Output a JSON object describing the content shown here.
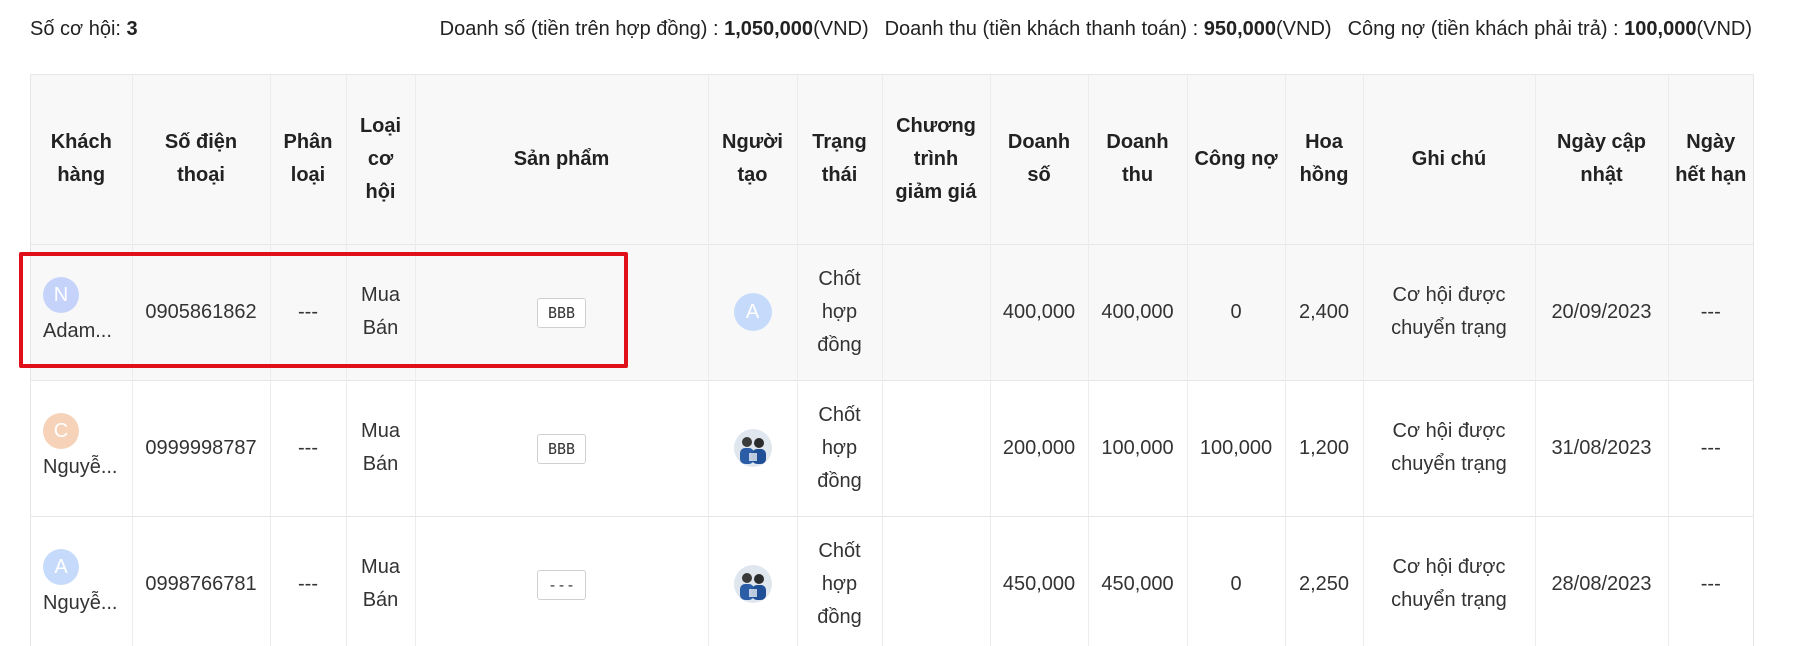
{
  "summary": {
    "count_label": "Số cơ hội: ",
    "count_value": "3",
    "sales_label": "Doanh số (tiền trên hợp đồng) : ",
    "sales_value": "1,050,000",
    "revenue_label": "Doanh thu (tiền khách thanh toán) : ",
    "revenue_value": "950,000",
    "debt_label": "Công nợ (tiền khách phải trả) : ",
    "debt_value": "100,000",
    "currency": "(VND)"
  },
  "table": {
    "headers": [
      "Khách hàng",
      "Số điện thoại",
      "Phân loại",
      "Loại cơ hội",
      "Sản phẩm",
      "Người tạo",
      "Trạng thái",
      "Chương trình giảm giá",
      "Doanh số",
      "Doanh thu",
      "Công nợ",
      "Hoa hồng",
      "Ghi chú",
      "Ngày cập nhật",
      "Ngày hết hạn"
    ],
    "rows": [
      {
        "avatar_letter": "N",
        "avatar_color": "#c5d3fb",
        "name": "Adam...",
        "phone": "0905861862",
        "category": "---",
        "opp_type": "Mua Bán",
        "product": "BBB",
        "creator_letter": "A",
        "creator_color": "#c6dbfb",
        "status": "Chốt hợp đồng",
        "discount": "",
        "sales": "400,000",
        "revenue": "400,000",
        "debt": "0",
        "commission": "2,400",
        "note": "Cơ hội được chuyển trạng",
        "updated": "20/09/2023",
        "expires": "---"
      },
      {
        "avatar_letter": "C",
        "avatar_color": "#f6d2b8",
        "name": "Nguyễ...",
        "phone": "0999998787",
        "category": "---",
        "opp_type": "Mua Bán",
        "product": "BBB",
        "status": "Chốt hợp đồng",
        "discount": "",
        "sales": "200,000",
        "revenue": "100,000",
        "debt": "100,000",
        "commission": "1,200",
        "note": "Cơ hội được chuyển trạng",
        "updated": "31/08/2023",
        "expires": "---"
      },
      {
        "avatar_letter": "A",
        "avatar_color": "#c6dbfb",
        "name": "Nguyễ...",
        "phone": "0998766781",
        "category": "---",
        "opp_type": "Mua Bán",
        "product": "---",
        "status": "Chốt hợp đồng",
        "discount": "",
        "sales": "450,000",
        "revenue": "450,000",
        "debt": "0",
        "commission": "2,250",
        "note": "Cơ hội được chuyển trạng",
        "updated": "28/08/2023",
        "expires": "---"
      }
    ]
  }
}
